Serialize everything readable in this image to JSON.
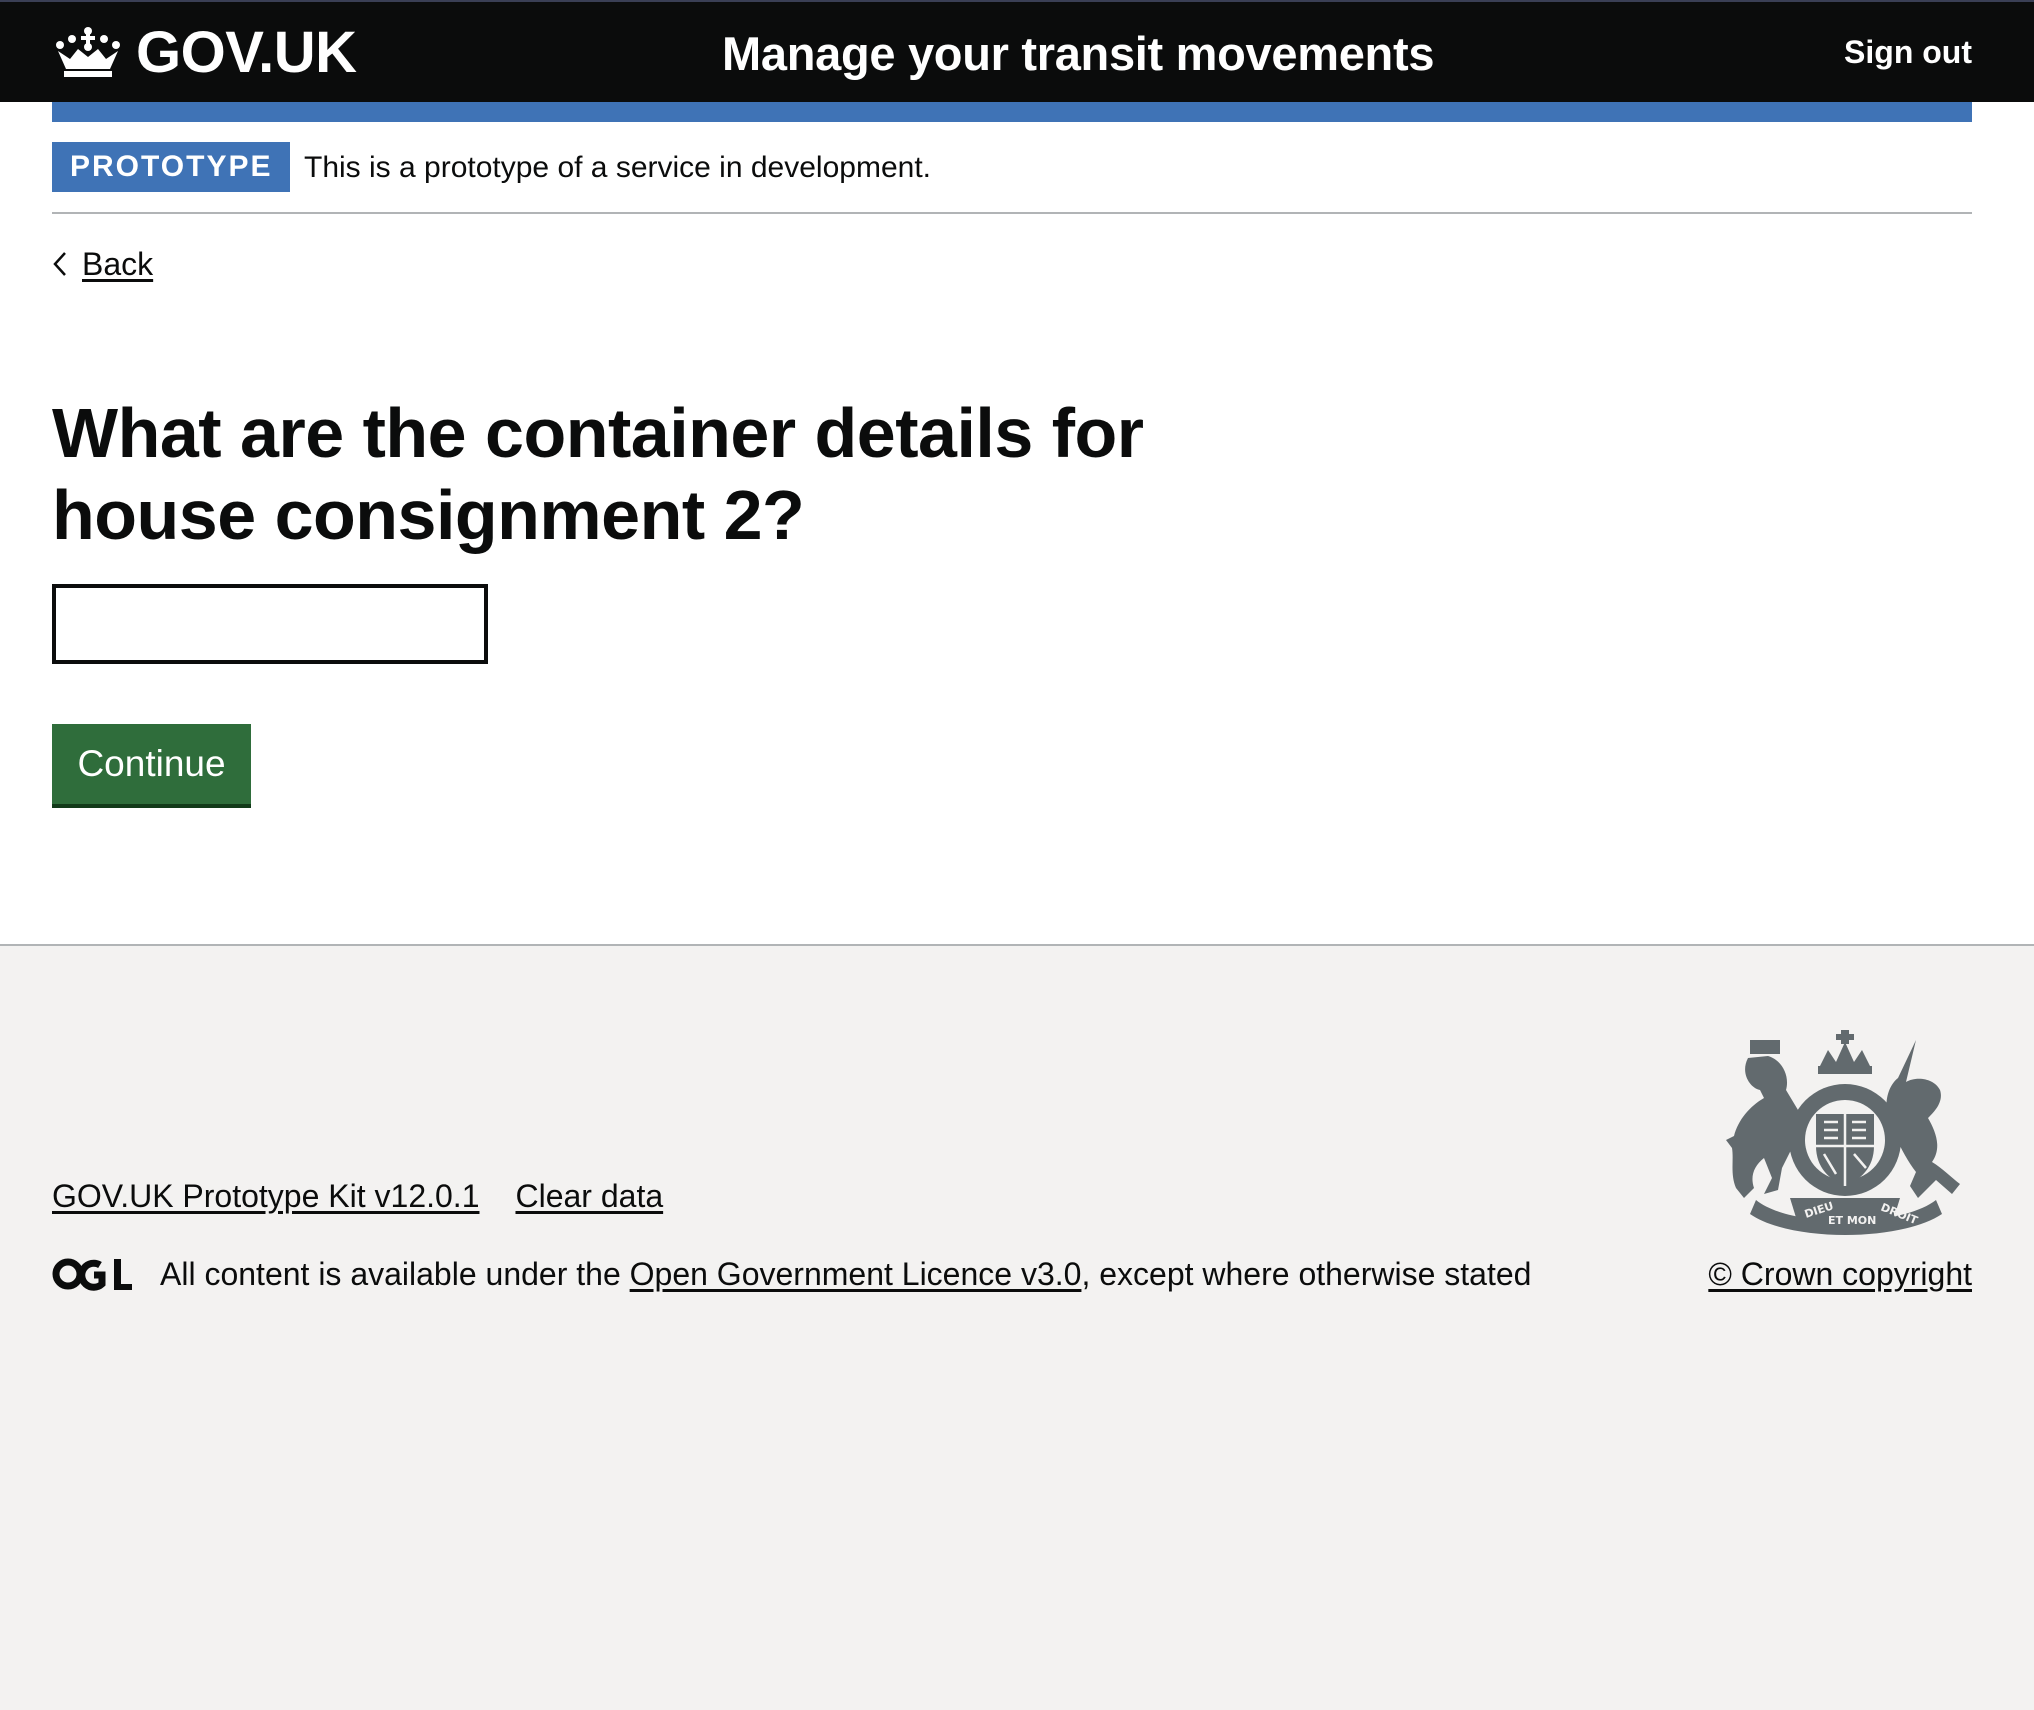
{
  "header": {
    "logo_text": "GOV.UK",
    "logo_icon": "crown-icon",
    "service_name": "Manage your transit movements",
    "sign_out_label": "Sign out",
    "background_color": "#0b0c0c",
    "accent_bar_color": "#3f73b6"
  },
  "phase_banner": {
    "tag": "PROTOTYPE",
    "text": "This is a prototype of a service in development.",
    "tag_color": "#3f73b6"
  },
  "back_link": {
    "label": "Back",
    "icon": "chevron-left-icon"
  },
  "question": {
    "heading": "What are the container details for house consignment 2?",
    "input_value": "",
    "continue_label": "Continue",
    "button_color": "#2f6d3b"
  },
  "footer": {
    "links": [
      "GOV.UK Prototype Kit v12.0.1",
      "Clear data"
    ],
    "ogl_logo": "ogl-logo-icon",
    "licence_prefix": "All content is available under the ",
    "licence_link": "Open Government Licence v3.0",
    "licence_suffix": ", except where otherwise stated",
    "crest_icon": "royal-coat-of-arms-icon",
    "copyright": "© Crown copyright",
    "background_color": "#f3f2f1"
  }
}
